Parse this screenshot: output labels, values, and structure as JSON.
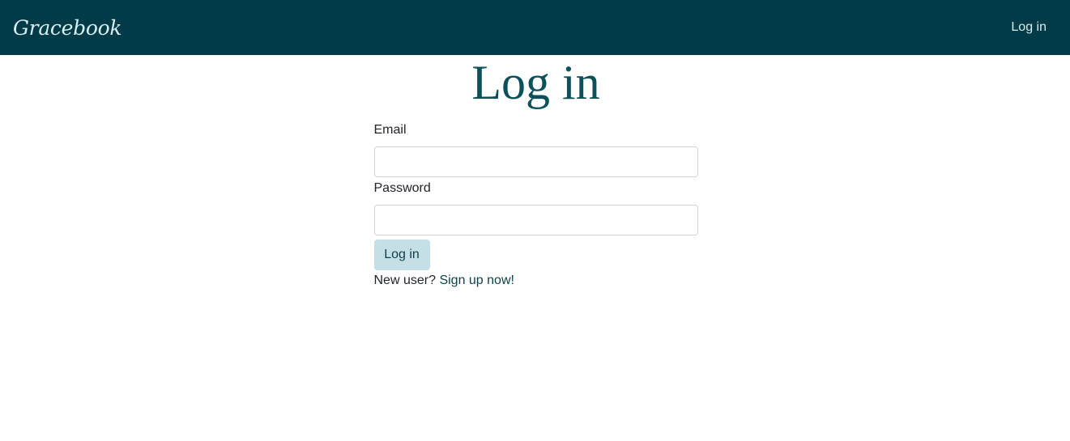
{
  "navbar": {
    "brand": "Gracebook",
    "login_link": "Log in",
    "background": "#003b47",
    "text_color": "#d8eef2"
  },
  "main": {
    "title": "Log in",
    "title_color": "#0c5159",
    "email_label": "Email",
    "email_value": "",
    "password_label": "Password",
    "password_value": "",
    "submit_label": "Log in",
    "button_color": "#c4e0e6",
    "signup_prompt": "New user?",
    "signup_link": "Sign up now!"
  }
}
